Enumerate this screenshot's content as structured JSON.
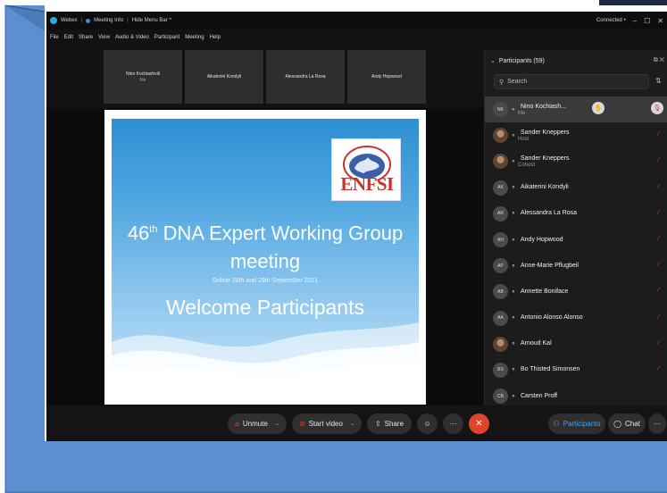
{
  "titlebar": {
    "app": "Webex",
    "meeting_info": "Meeting Info",
    "hide_menu": "Hide Menu Bar ^",
    "status": "Connected •",
    "minimize": "–",
    "maximize": "☐",
    "close": "✕"
  },
  "menu": [
    "File",
    "Edit",
    "Share",
    "View",
    "Audio & Video",
    "Participant",
    "Meeting",
    "Help"
  ],
  "video_tiles": [
    {
      "name": "Nino Kochiashvili",
      "sub": "Me"
    },
    {
      "name": "Aikaterini Kondyli",
      "sub": ""
    },
    {
      "name": "Alessandra La Rosa",
      "sub": ""
    },
    {
      "name": "Andy Hopwood",
      "sub": ""
    }
  ],
  "slide": {
    "logo_text": "ENFSI",
    "title_prefix": "46",
    "title_sup": "th",
    "title_line1_rest": " DNA Expert Working Group",
    "title_line2": "meeting",
    "date": "Online 28th and 29th September 2021",
    "welcome": "Welcome Participants"
  },
  "participants_panel": {
    "title": "Participants (59)",
    "search_placeholder": "Search",
    "list": [
      {
        "initials": "NK",
        "name": "Nino Kochiash...",
        "role": "Me",
        "photo": false
      },
      {
        "initials": "",
        "name": "Sander Kneppers",
        "role": "Host",
        "photo": true
      },
      {
        "initials": "",
        "name": "Sander Kneppers",
        "role": "Cohost",
        "photo": true
      },
      {
        "initials": "AK",
        "name": "Aikaterini Kondyli",
        "role": "",
        "photo": false
      },
      {
        "initials": "AR",
        "name": "Alessandra La Rosa",
        "role": "",
        "photo": false
      },
      {
        "initials": "AH",
        "name": "Andy Hopwood",
        "role": "",
        "photo": false
      },
      {
        "initials": "AP",
        "name": "Anne-Marie Pflugbeil",
        "role": "",
        "photo": false
      },
      {
        "initials": "AB",
        "name": "Annette Boniface",
        "role": "",
        "photo": false
      },
      {
        "initials": "AA",
        "name": "Antonio Alonso Alonso",
        "role": "",
        "photo": false
      },
      {
        "initials": "",
        "name": "Arnoud Kal",
        "role": "",
        "photo": true
      },
      {
        "initials": "BS",
        "name": "Bo Thisted Simonsen",
        "role": "",
        "photo": false
      },
      {
        "initials": "CB",
        "name": "Carsten Proff",
        "role": "",
        "photo": false
      }
    ]
  },
  "controls": {
    "unmute": "Unmute",
    "start_video": "Start video",
    "share": "Share",
    "more": "···",
    "participants": "Participants",
    "chat": "Chat"
  },
  "colors": {
    "frame_blue": "#5b8fd0",
    "mute_red": "#e0442c",
    "panel_bg": "#1c1c1c"
  }
}
